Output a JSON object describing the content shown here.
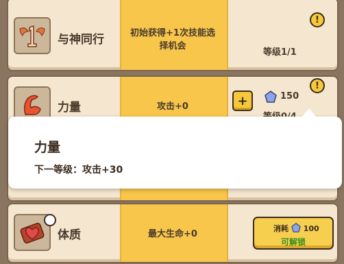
{
  "skills": [
    {
      "name": "与神同行",
      "icon": "winged-one-icon",
      "effect_lines": [
        "初始获得+1次技能选",
        "择机会"
      ],
      "level_text": "等级1/1",
      "has_alert": true
    },
    {
      "name": "力量",
      "icon": "flexed-arm-icon",
      "effect": "攻击+0",
      "upgrade_cost": "150",
      "level_text": "等级0/4",
      "has_alert": true,
      "has_plus": true
    },
    {
      "name": "体质",
      "icon": "locked-heart-icon",
      "effect": "最大生命+0",
      "unlock_cost_label": "消耗",
      "unlock_cost": "100",
      "unlock_label": "可解锁"
    }
  ],
  "tooltip": {
    "title": "力量",
    "description": "下一等级：攻击+30"
  },
  "colors": {
    "accent_yellow": "#f7c64b",
    "card_bg": "#f4e6cf",
    "gem_blue": "#8aa6e8",
    "unlock_green": "#3a8f1e"
  }
}
